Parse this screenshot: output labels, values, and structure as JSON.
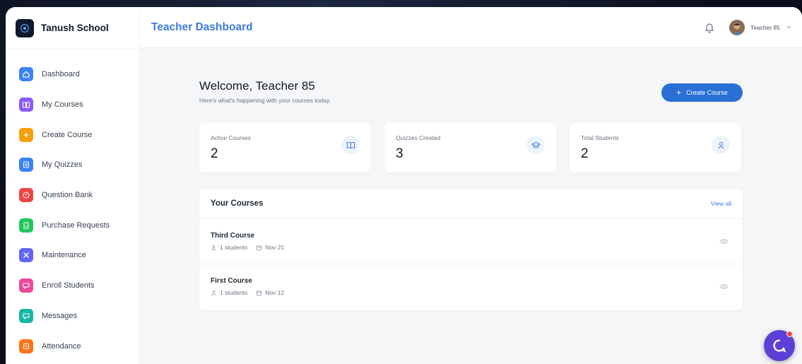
{
  "brand": {
    "name": "Tanush School"
  },
  "header": {
    "title": "Teacher Dashboard",
    "user_name": "Teacher 85"
  },
  "sidebar": {
    "items": [
      {
        "label": "Dashboard",
        "icon": "home-icon",
        "color": "#3b82f6"
      },
      {
        "label": "My Courses",
        "icon": "book-icon",
        "color": "#8b5cf6"
      },
      {
        "label": "Create Course",
        "icon": "plus-icon",
        "color": "#f59e0b"
      },
      {
        "label": "My Quizzes",
        "icon": "quiz-icon",
        "color": "#3b82f6"
      },
      {
        "label": "Question Bank",
        "icon": "question-icon",
        "color": "#ef4444"
      },
      {
        "label": "Purchase Requests",
        "icon": "document-icon",
        "color": "#22c55e"
      },
      {
        "label": "Maintenance",
        "icon": "wrench-icon",
        "color": "#6366f1"
      },
      {
        "label": "Enroll Students",
        "icon": "enroll-icon",
        "color": "#ec4899"
      },
      {
        "label": "Messages",
        "icon": "message-icon",
        "color": "#14b8a6"
      },
      {
        "label": "Attendance",
        "icon": "attendance-icon",
        "color": "#f97316"
      }
    ]
  },
  "main": {
    "welcome_title": "Welcome, Teacher 85",
    "welcome_subtitle": "Here's what's happening with your courses today.",
    "create_button_label": "Create Course",
    "stats": [
      {
        "label": "Active Courses",
        "value": "2",
        "icon": "book-open-icon"
      },
      {
        "label": "Quizzes Created",
        "value": "3",
        "icon": "graduation-cap-icon"
      },
      {
        "label": "Total Students",
        "value": "2",
        "icon": "students-icon"
      }
    ],
    "courses_title": "Your Courses",
    "view_all_label": "View all",
    "courses": [
      {
        "name": "Third Course",
        "students": "1 students",
        "date": "Nov 21"
      },
      {
        "name": "First Course",
        "students": "1 students",
        "date": "Nov 12"
      }
    ]
  },
  "colors": {
    "accent": "#3e7bd9",
    "button": "#2a6fd6",
    "chat": "#5b3fd6",
    "badge": "#ef4444"
  }
}
